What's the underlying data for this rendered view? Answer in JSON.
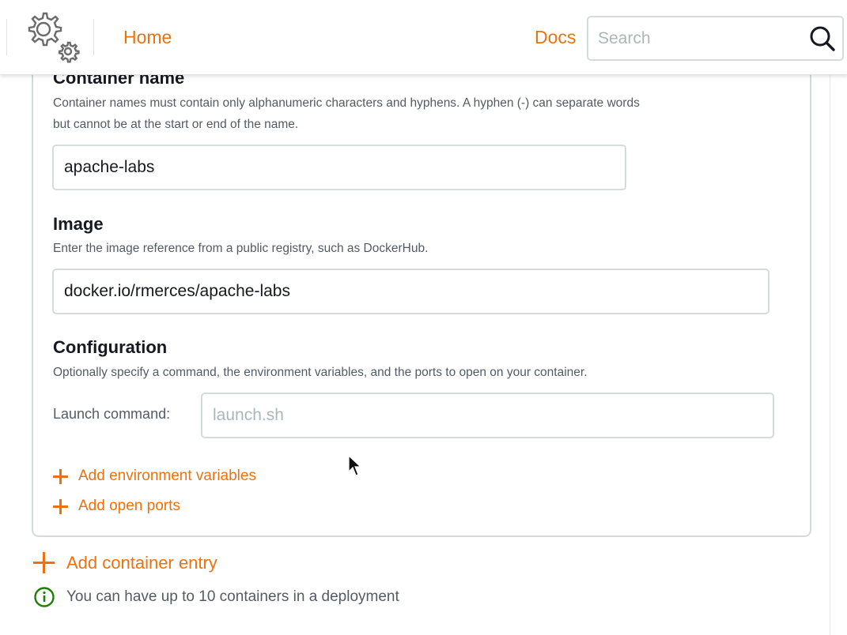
{
  "header": {
    "logo_icon": "gear-logo-icon",
    "home_label": "Home",
    "docs_label": "Docs",
    "search_placeholder": "Search",
    "search_value": "",
    "search_icon": "search-icon"
  },
  "form": {
    "container_name": {
      "title": "Container name",
      "hint_line1": "Container names must contain only alphanumeric characters and hyphens. A hyphen (-) can separate words",
      "hint_line2": "but cannot be at the start or end of the name.",
      "value": "apache-labs"
    },
    "image": {
      "title": "Image",
      "hint": "Enter the image reference from a public registry, such as DockerHub.",
      "value": "docker.io/rmerces/apache-labs"
    },
    "configuration": {
      "title": "Configuration",
      "hint": "Optionally specify a command, the environment variables, and the ports to open on your container.",
      "launch_label": "Launch command:",
      "launch_placeholder": "launch.sh",
      "launch_value": "",
      "add_env_label": "Add environment variables",
      "add_ports_label": "Add open ports"
    }
  },
  "footer": {
    "add_container_label": "Add container entry",
    "info_text": "You can have up to 10 containers in a deployment",
    "info_icon": "info-circle-icon"
  },
  "colors": {
    "accent": "#ec7211",
    "border": "#d5dbdb",
    "text": "#16191f",
    "muted": "#545b64",
    "info_green": "#1d8102"
  }
}
